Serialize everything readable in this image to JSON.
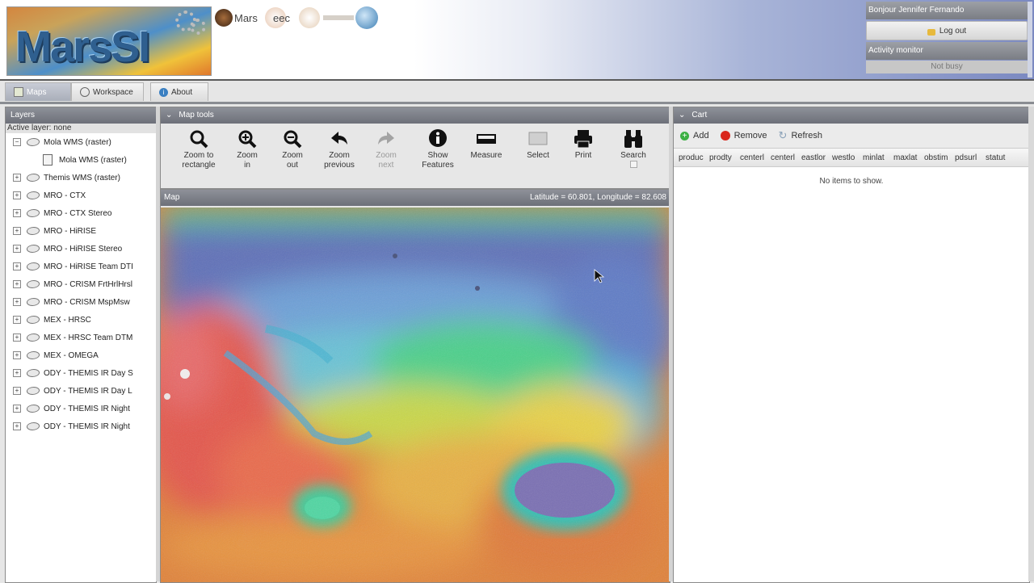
{
  "header": {
    "logo_text": "MarsSI",
    "partners": [
      "Mars",
      "eec",
      "",
      ""
    ],
    "greeting": "Bonjour Jennifer Fernando",
    "logout_label": "Log out",
    "activity_title": "Activity monitor",
    "activity_status": "Not busy"
  },
  "tabs": [
    {
      "label": "Maps",
      "icon": "map-icon",
      "active": true
    },
    {
      "label": "Workspace",
      "icon": "workspace-icon",
      "active": false
    },
    {
      "label": "About",
      "icon": "info-icon",
      "active": false
    }
  ],
  "layers": {
    "title": "Layers",
    "active_layer": "Active layer: none",
    "items": [
      {
        "label": "Mola WMS (raster)",
        "expanded": true,
        "children": [
          {
            "label": "Mola WMS (raster)"
          }
        ]
      },
      {
        "label": "Themis WMS (raster)"
      },
      {
        "label": "MRO - CTX"
      },
      {
        "label": "MRO - CTX Stereo"
      },
      {
        "label": "MRO - HiRISE"
      },
      {
        "label": "MRO - HiRISE Stereo"
      },
      {
        "label": "MRO - HiRISE Team DTI"
      },
      {
        "label": "MRO - CRISM FrtHrlHrsl"
      },
      {
        "label": "MRO - CRISM MspMsw"
      },
      {
        "label": "MEX - HRSC"
      },
      {
        "label": "MEX - HRSC Team DTM"
      },
      {
        "label": "MEX - OMEGA"
      },
      {
        "label": "ODY - THEMIS IR Day S"
      },
      {
        "label": "ODY - THEMIS IR Day L"
      },
      {
        "label": "ODY - THEMIS IR Night"
      },
      {
        "label": "ODY - THEMIS IR Night"
      }
    ]
  },
  "map_tools": {
    "title": "Map tools",
    "tools": [
      {
        "line1": "Zoom to",
        "line2": "rectangle",
        "icon": "zoom-rectangle-icon",
        "enabled": true
      },
      {
        "line1": "Zoom",
        "line2": "in",
        "icon": "zoom-in-icon",
        "enabled": true
      },
      {
        "line1": "Zoom",
        "line2": "out",
        "icon": "zoom-out-icon",
        "enabled": true
      },
      {
        "line1": "Zoom",
        "line2": "previous",
        "icon": "arrow-back-icon",
        "enabled": true
      },
      {
        "line1": "Zoom",
        "line2": "next",
        "icon": "arrow-forward-icon",
        "enabled": false
      },
      {
        "line1": "Show",
        "line2": "Features",
        "icon": "info-icon",
        "enabled": true
      },
      {
        "line1": "Measure",
        "line2": "",
        "icon": "ruler-icon",
        "enabled": true
      },
      {
        "line1": "Select",
        "line2": "",
        "icon": "select-icon",
        "enabled": true
      },
      {
        "line1": "Print",
        "line2": "",
        "icon": "printer-icon",
        "enabled": true
      },
      {
        "line1": "Search",
        "line2": "",
        "icon": "binoculars-icon",
        "enabled": true
      }
    ]
  },
  "map": {
    "title": "Map",
    "coords": "Latitude = 60.801, Longitude = 82.608"
  },
  "cart": {
    "title": "Cart",
    "actions": [
      {
        "label": "Add",
        "icon": "add-icon",
        "color": "#3cb043"
      },
      {
        "label": "Remove",
        "icon": "remove-icon",
        "color": "#d9261c"
      },
      {
        "label": "Refresh",
        "icon": "refresh-icon",
        "color": "#8aa1b8"
      }
    ],
    "columns": [
      "produc",
      "prodty",
      "centerl",
      "centerl",
      "eastlor",
      "westlo",
      "minlat",
      "maxlat",
      "obstim",
      "pdsurl",
      "statut"
    ],
    "empty_text": "No items to show."
  }
}
